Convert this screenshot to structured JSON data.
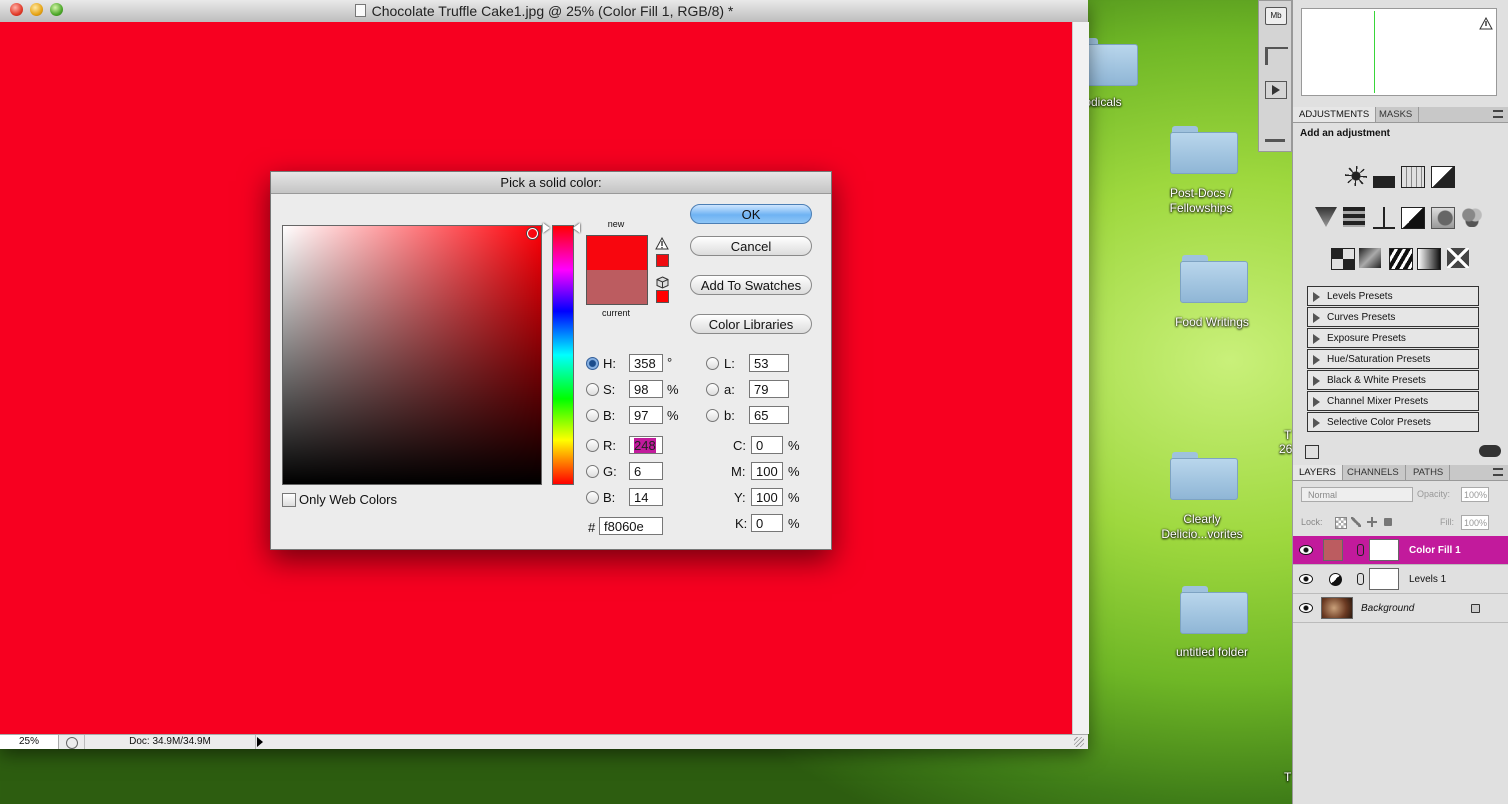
{
  "window": {
    "title": "Chocolate Truffle Cake1.jpg @ 25% (Color Fill 1, RGB/8) *",
    "zoom": "25%",
    "doc_info": "Doc: 34.9M/34.9M"
  },
  "desktop": {
    "items": [
      {
        "label": "odicals"
      },
      {
        "label": "Post-Docs /\nFellowships"
      },
      {
        "label": "Food Writings"
      },
      {
        "label": "Clearly\nDelicio...vorites"
      },
      {
        "label": "untitled folder"
      }
    ],
    "edge_text": [
      "T",
      "26",
      "T"
    ]
  },
  "dialog": {
    "title": "Pick a solid color:",
    "new_label": "new",
    "current_label": "current",
    "new_color": "#f8060e",
    "current_color": "#bc5c60",
    "buttons": {
      "ok": "OK",
      "cancel": "Cancel",
      "add_swatches": "Add To Swatches",
      "color_libraries": "Color Libraries"
    },
    "only_web_colors": "Only Web Colors",
    "fields": {
      "H": {
        "label": "H:",
        "value": "358",
        "unit": "°"
      },
      "S": {
        "label": "S:",
        "value": "98",
        "unit": "%"
      },
      "B": {
        "label": "B:",
        "value": "97",
        "unit": "%"
      },
      "R": {
        "label": "R:",
        "value": "248"
      },
      "G": {
        "label": "G:",
        "value": "6"
      },
      "Bl": {
        "label": "B:",
        "value": "14"
      },
      "L": {
        "label": "L:",
        "value": "53"
      },
      "a": {
        "label": "a:",
        "value": "79"
      },
      "b": {
        "label": "b:",
        "value": "65"
      },
      "C": {
        "label": "C:",
        "value": "0",
        "unit": "%"
      },
      "M": {
        "label": "M:",
        "value": "100",
        "unit": "%"
      },
      "Y": {
        "label": "Y:",
        "value": "100",
        "unit": "%"
      },
      "K": {
        "label": "K:",
        "value": "0",
        "unit": "%"
      }
    },
    "hex_label": "#",
    "hex_value": "f8060e"
  },
  "adjustments": {
    "tabs": [
      "ADJUSTMENTS",
      "MASKS"
    ],
    "subtitle": "Add an adjustment",
    "presets": [
      "Levels Presets",
      "Curves Presets",
      "Exposure Presets",
      "Hue/Saturation Presets",
      "Black & White Presets",
      "Channel Mixer Presets",
      "Selective Color Presets"
    ]
  },
  "layers": {
    "tabs": [
      "LAYERS",
      "CHANNELS",
      "PATHS"
    ],
    "blend_mode": "Normal",
    "opacity_label": "Opacity:",
    "opacity": "100%",
    "lock_label": "Lock:",
    "fill_label": "Fill:",
    "fill": "100%",
    "items": [
      {
        "name": "Color Fill 1",
        "selected": true
      },
      {
        "name": "Levels 1",
        "selected": false
      },
      {
        "name": "Background",
        "selected": false
      }
    ]
  },
  "colors": {
    "selection": "#c21a9c",
    "canvas": "#f70020"
  }
}
